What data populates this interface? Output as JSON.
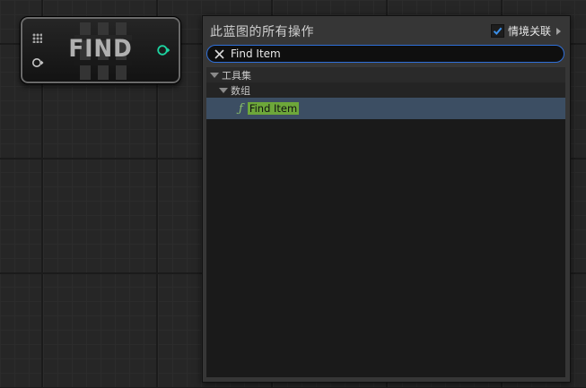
{
  "node": {
    "title": "FIND",
    "icons": {
      "grid": "grid-dots-icon",
      "exec_in": "exec-pin-icon",
      "exec_out": "exec-pin-icon"
    },
    "colors": {
      "exec_out_pin": "#1dd3a0",
      "exec_in_pin": "#c8c8c8"
    }
  },
  "menu": {
    "title": "此蓝图的所有操作",
    "context_sensitive": {
      "label": "情境关联",
      "checked": true
    },
    "search": {
      "value": "Find Item",
      "clear_icon": "close-icon"
    },
    "tree": {
      "categories": [
        {
          "label": "工具集",
          "expanded": true
        },
        {
          "label": "数组",
          "expanded": true
        }
      ],
      "items": [
        {
          "label": "Find Item",
          "icon": "function-icon",
          "selected": true
        }
      ]
    },
    "colors": {
      "accent": "#2f6fd8",
      "selection": "#3c4e63",
      "highlight": "#6da73a"
    }
  }
}
